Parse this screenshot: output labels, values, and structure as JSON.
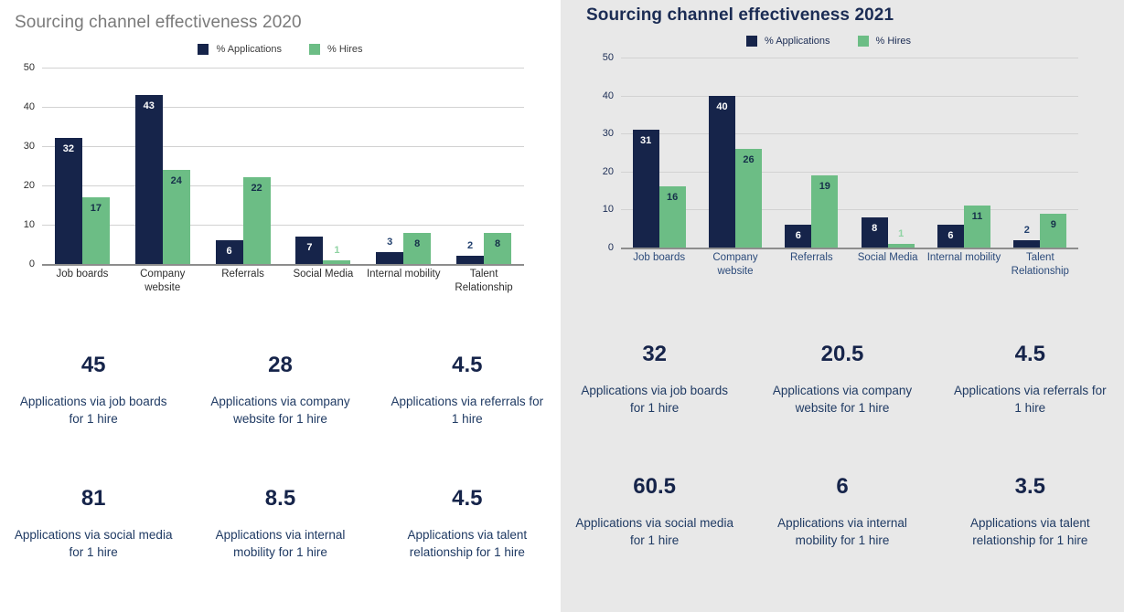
{
  "panels": [
    {
      "title": "Sourcing channel effectiveness 2020",
      "legend": [
        {
          "label": "% Applications",
          "color": "#16244a",
          "icon": "legend-swatch-applications"
        },
        {
          "label": "% Hires",
          "color": "#6cbd85",
          "icon": "legend-swatch-hires"
        }
      ],
      "chart_data": {
        "type": "bar",
        "title": "Sourcing channel effectiveness 2020",
        "xlabel": "",
        "ylabel": "",
        "ylim": [
          0,
          50
        ],
        "yticks": [
          50,
          40,
          30,
          20,
          10,
          0
        ],
        "grid": true,
        "legend_position": "top-center",
        "categories": [
          "Job boards",
          "Company website",
          "Referrals",
          "Social Media",
          "Internal mobility",
          "Talent Relationship"
        ],
        "series": [
          {
            "name": "% Applications",
            "color": "#16244a",
            "values": [
              32,
              43,
              6,
              7,
              3,
              2
            ]
          },
          {
            "name": "% Hires",
            "color": "#6cbd85",
            "values": [
              17,
              24,
              22,
              1,
              8,
              8
            ]
          }
        ]
      },
      "stats": [
        {
          "value": "45",
          "caption": "Applications via job boards for 1 hire"
        },
        {
          "value": "28",
          "caption": "Applications via company website for 1 hire"
        },
        {
          "value": "4.5",
          "caption": "Applications via referrals for 1 hire"
        },
        {
          "value": "81",
          "caption": "Applications via social media for 1 hire"
        },
        {
          "value": "8.5",
          "caption": "Applications via internal mobility for 1 hire"
        },
        {
          "value": "4.5",
          "caption": "Applications via talent relationship for 1 hire"
        }
      ]
    },
    {
      "title": "Sourcing channel effectiveness 2021",
      "legend": [
        {
          "label": "% Applications",
          "color": "#16244a",
          "icon": "legend-swatch-applications"
        },
        {
          "label": "% Hires",
          "color": "#6cbd85",
          "icon": "legend-swatch-hires"
        }
      ],
      "chart_data": {
        "type": "bar",
        "title": "Sourcing channel effectiveness 2021",
        "xlabel": "",
        "ylabel": "",
        "ylim": [
          0,
          50
        ],
        "yticks": [
          50,
          40,
          30,
          20,
          10,
          0
        ],
        "grid": true,
        "legend_position": "top-center",
        "categories": [
          "Job boards",
          "Company website",
          "Referrals",
          "Social Media",
          "Internal mobility",
          "Talent Relationship"
        ],
        "series": [
          {
            "name": "% Applications",
            "color": "#16244a",
            "values": [
              31,
              40,
              6,
              8,
              6,
              2
            ]
          },
          {
            "name": "% Hires",
            "color": "#6cbd85",
            "values": [
              16,
              26,
              19,
              1,
              11,
              9
            ]
          }
        ]
      },
      "stats": [
        {
          "value": "32",
          "caption": "Applications via job boards for 1 hire"
        },
        {
          "value": "20.5",
          "caption": "Applications via company website for 1 hire"
        },
        {
          "value": "4.5",
          "caption": "Applications via referrals for 1 hire"
        },
        {
          "value": "60.5",
          "caption": "Applications via social media for 1 hire"
        },
        {
          "value": "6",
          "caption": "Applications via internal mobility for 1 hire"
        },
        {
          "value": "3.5",
          "caption": "Applications via talent relationship for 1 hire"
        }
      ]
    }
  ]
}
